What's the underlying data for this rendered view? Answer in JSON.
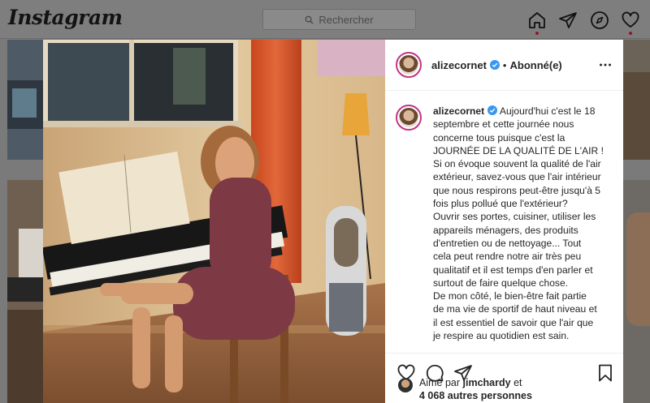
{
  "app": {
    "name": "Instagram"
  },
  "search": {
    "placeholder": "Rechercher"
  },
  "nav": {
    "icons": [
      "home-icon",
      "direct-icon",
      "explore-icon",
      "activity-heart-icon"
    ]
  },
  "post": {
    "username": "alizecornet",
    "follow_status": "Abonné(e)",
    "separator": "•",
    "caption_lines": [
      "Aujourd'hui c'est le 18",
      "septembre et cette journée nous",
      "concerne tous puisque c'est la",
      "JOURNÉE DE LA QUALITÉ DE L'AIR !",
      "Si on évoque souvent la qualité de l'air",
      "extérieur, savez-vous que l'air intérieur",
      "que nous respirons peut-être jusqu'à 5",
      "fois plus pollué que l'extérieur?",
      "Ouvrir ses portes, cuisiner, utiliser les",
      "appareils ménagers, des produits",
      "d'entretien ou de nettoyage... Tout",
      "cela peut rendre notre air très peu",
      "qualitatif et il est temps d'en parler et",
      "surtout de faire quelque chose.",
      "De mon côté, le bien-être fait partie",
      "de ma vie de sportif de haut niveau et",
      "il est essentiel de savoir que l'air que",
      "je respire au quotidien est sain."
    ],
    "likes": {
      "prefix": "Aimé par",
      "user": "jimchardy",
      "conj": "et",
      "others": "4 068 autres personnes"
    },
    "colors": {
      "verified": "#3897f0",
      "avatar_ring": "#c13584"
    }
  }
}
